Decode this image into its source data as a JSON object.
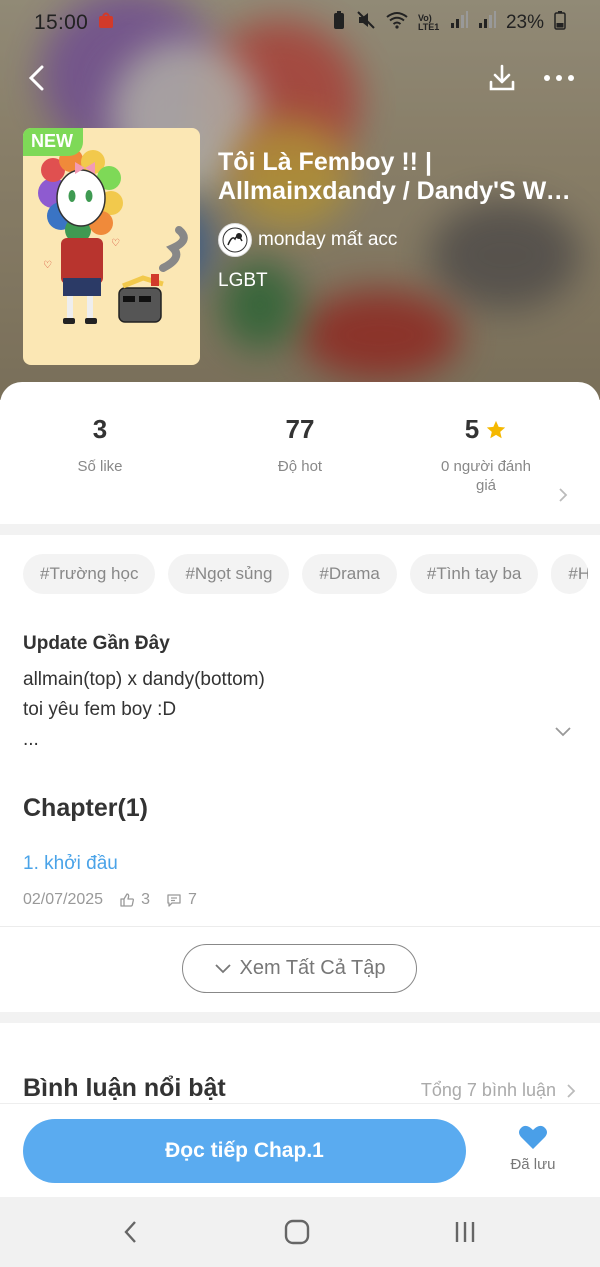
{
  "status_bar": {
    "time": "15:00",
    "battery": "23%",
    "network": "Vo) LTE1"
  },
  "header": {
    "back_icon": "chevron-left-icon",
    "download_icon": "download-icon",
    "more_icon": "more-horizontal-icon"
  },
  "story": {
    "badge": "NEW",
    "title_line1": "Tôi Là Femboy !! |",
    "title_line2": "Allmainxdandy / Dandy'S Wo...",
    "author": "monday mất acc",
    "genre": "LGBT"
  },
  "stats": {
    "likes_value": "3",
    "likes_label": "Số like",
    "hot_value": "77",
    "hot_label": "Độ hot",
    "rating_value": "5",
    "rating_label": "0 người đánh giá"
  },
  "tags": [
    "#Trường học",
    "#Ngọt sủng",
    "#Drama",
    "#Tình tay ba",
    "#H"
  ],
  "update": {
    "title": "Update Gần Đây",
    "lines": [
      "allmain(top) x dandy(bottom)",
      "toi yêu fem boy :D",
      "..."
    ]
  },
  "chapters": {
    "heading": "Chapter(1)",
    "items": [
      {
        "title": "1. khởi đầu",
        "date": "02/07/2025",
        "likes": "3",
        "comments": "7"
      }
    ],
    "view_all_label": "Xem Tất Cả Tập"
  },
  "comments": {
    "heading": "Bình luận nổi bật",
    "total_label": "Tổng 7 bình luận"
  },
  "actions": {
    "read_label": "Đọc tiếp Chap.1",
    "saved_label": "Đã lưu"
  },
  "colors": {
    "accent_blue": "#5aabf0",
    "link_blue": "#4aa3e8",
    "new_badge_green": "#7ed957",
    "star_yellow": "#f5b800",
    "heart_blue": "#4a9fe8"
  }
}
